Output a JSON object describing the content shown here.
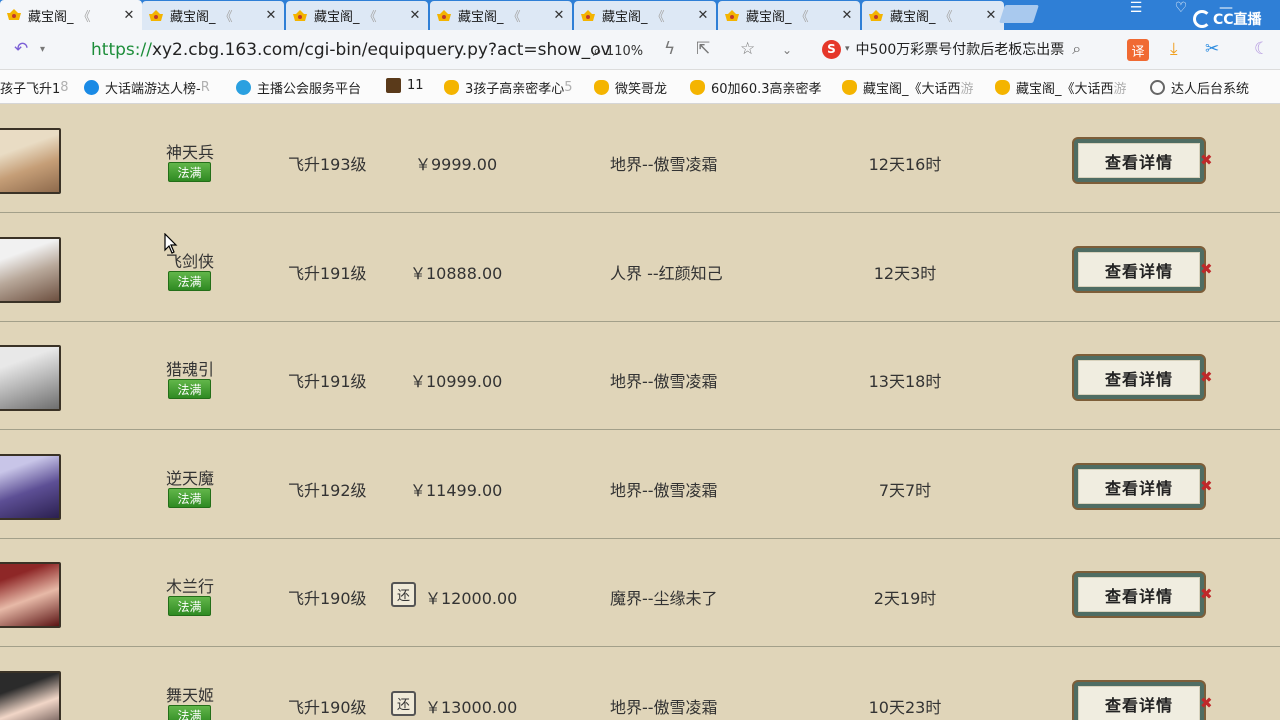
{
  "browser": {
    "tabs": [
      {
        "title": "藏宝阁_",
        "fade": "《",
        "active": true
      },
      {
        "title": "藏宝阁_",
        "fade": "《",
        "active": false
      },
      {
        "title": "藏宝阁_",
        "fade": "《",
        "active": false
      },
      {
        "title": "藏宝阁_",
        "fade": "《",
        "active": false
      },
      {
        "title": "藏宝阁_",
        "fade": "《",
        "active": false
      },
      {
        "title": "藏宝阁_",
        "fade": "《",
        "active": false
      },
      {
        "title": "藏宝阁_",
        "fade": "《",
        "active": false
      }
    ],
    "url_protocol": "https://",
    "url_rest": "xy2.cbg.163.com/cgi-bin/equipquery.py?act=show_ov",
    "zoom": "110%",
    "search_hint": "中500万彩票号付款后老板忘出票",
    "translate_label": "译",
    "stream_logo": "CC直播"
  },
  "bookmarks": [
    {
      "label": "孩子飞升1",
      "fade": "8",
      "icon": "none"
    },
    {
      "label": "大话端游达人榜-",
      "fade": "R",
      "icon": "dh"
    },
    {
      "label": "主播公会服务平台",
      "fade": "",
      "icon": "zb"
    },
    {
      "label": "11",
      "fade": "",
      "icon": "game"
    },
    {
      "label": "3孩子高亲密孝心",
      "fade": "5",
      "icon": "cbg"
    },
    {
      "label": "微笑哥龙",
      "fade": "",
      "icon": "cbg"
    },
    {
      "label": "60加60.3高亲密孝",
      "fade": "",
      "icon": "cbg"
    },
    {
      "label": "藏宝阁_《大话西",
      "fade": "游",
      "icon": "cbg"
    },
    {
      "label": "藏宝阁_《大话西",
      "fade": "游",
      "icon": "cbg"
    },
    {
      "label": "达人后台系统",
      "fade": "",
      "icon": "globe"
    }
  ],
  "listings": [
    {
      "name": "神天兵",
      "badge": "法满",
      "level": "飞升193级",
      "price": "￥9999.00",
      "refund": false,
      "server": "地界--傲雪凌霜",
      "time": "12天16时",
      "button": "查看详情"
    },
    {
      "name": "飞剑侠",
      "badge": "法满",
      "level": "飞升191级",
      "price": "￥10888.00",
      "refund": false,
      "server": "人界 --红颜知己",
      "time": "12天3时",
      "button": "查看详情"
    },
    {
      "name": "猎魂引",
      "badge": "法满",
      "level": "飞升191级",
      "price": "￥10999.00",
      "refund": false,
      "server": "地界--傲雪凌霜",
      "time": "13天18时",
      "button": "查看详情"
    },
    {
      "name": "逆天魔",
      "badge": "法满",
      "level": "飞升192级",
      "price": "￥11499.00",
      "refund": false,
      "server": "地界--傲雪凌霜",
      "time": "7天7时",
      "button": "查看详情"
    },
    {
      "name": "木兰行",
      "badge": "法满",
      "level": "飞升190级",
      "price": "￥12000.00",
      "refund": true,
      "refund_label": "还",
      "server": "魔界--尘缘未了",
      "time": "2天19时",
      "button": "查看详情"
    },
    {
      "name": "舞天姬",
      "badge": "法满",
      "level": "飞升190级",
      "price": "￥13000.00",
      "refund": true,
      "refund_label": "还",
      "server": "地界--傲雪凌霜",
      "time": "10天23时",
      "button": "查看详情"
    }
  ]
}
